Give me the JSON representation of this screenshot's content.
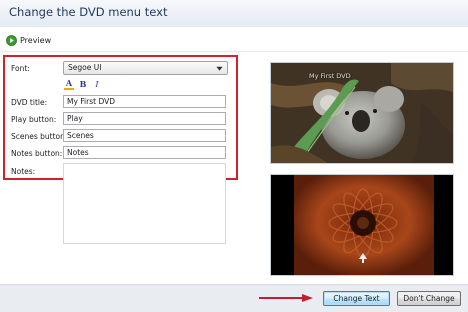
{
  "window": {
    "title": "Change the DVD menu text"
  },
  "toolbar": {
    "preview_label": "Preview",
    "preview_icon": "play-circle-icon"
  },
  "form": {
    "font_label": "Font:",
    "font_value": "Segoe UI",
    "format_buttons": {
      "color": "A",
      "bold": "B",
      "italic": "I"
    },
    "dvd_title_label": "DVD title:",
    "dvd_title_value": "My First DVD",
    "play_button_label": "Play button:",
    "play_button_value": "Play",
    "scenes_button_label": "Scenes button:",
    "scenes_button_value": "Scenes",
    "notes_button_label": "Notes button:",
    "notes_button_value": "Notes",
    "notes_label": "Notes:",
    "notes_value": ""
  },
  "preview": {
    "menu_title_text": "My First DVD"
  },
  "buttons": {
    "change_text": "Change Text",
    "dont_change": "Don't Change"
  },
  "colors": {
    "highlight_border": "#d0222d",
    "title_text": "#1e395b",
    "primary_button_border": "#3c7fb1",
    "annotation_arrow": "#c0202a"
  }
}
